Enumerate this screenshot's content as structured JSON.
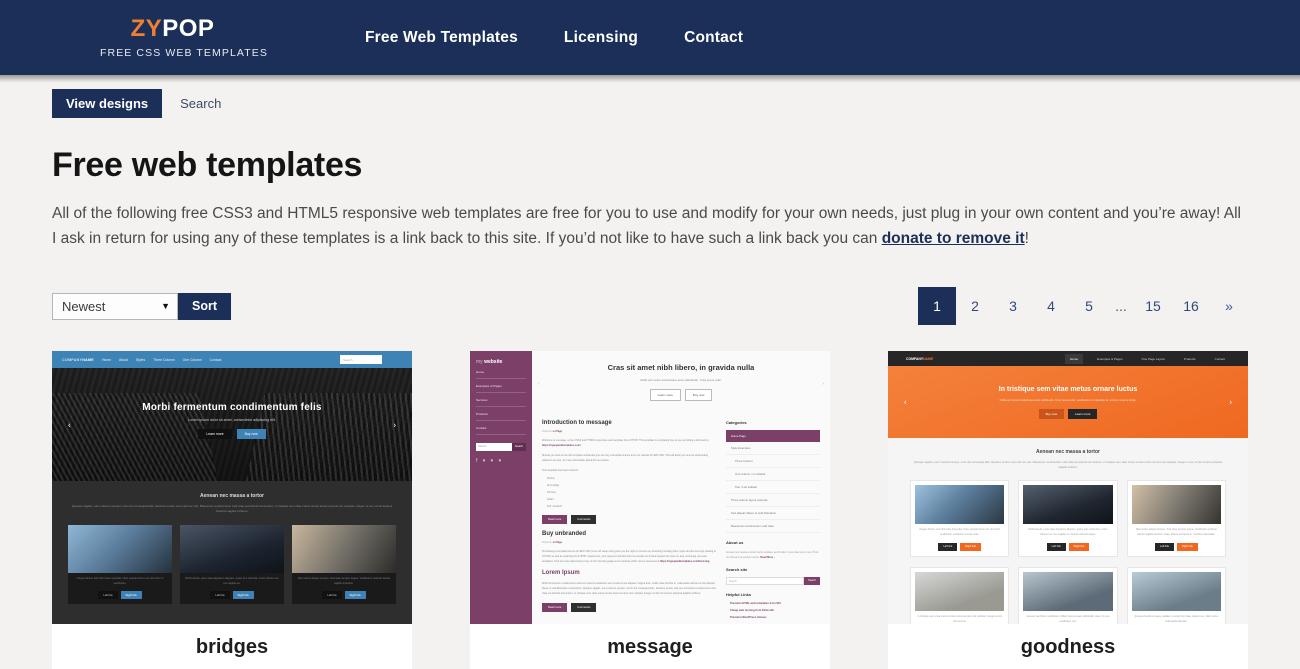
{
  "header": {
    "logo": {
      "part1": "ZY",
      "part2": "POP",
      "tagline": "FREE CSS WEB TEMPLATES"
    },
    "nav": [
      {
        "label": "Free Web Templates"
      },
      {
        "label": "Licensing"
      },
      {
        "label": "Contact"
      }
    ]
  },
  "subnav": {
    "tabs": [
      {
        "label": "View designs",
        "active": true
      },
      {
        "label": "Search",
        "active": false
      }
    ]
  },
  "main": {
    "title": "Free web templates",
    "intro_part1": "All of the following free CSS3 and HTML5 responsive web templates are free for you to use and modify for your own needs, just plug in your own content and you’re away! All I ask in return for using any of these templates is a link back to this site. If you’d not like to have such a link back you can ",
    "intro_link": "donate to remove it",
    "intro_part2": "!"
  },
  "controls": {
    "sort_value": "Newest",
    "sort_caret": "▼",
    "sort_button": "Sort",
    "sort_options": [
      "Newest"
    ]
  },
  "pagination": {
    "pages": [
      {
        "label": "1",
        "active": true
      },
      {
        "label": "2",
        "active": false
      },
      {
        "label": "3",
        "active": false
      },
      {
        "label": "4",
        "active": false
      },
      {
        "label": "5",
        "active": false
      },
      {
        "label": "...",
        "active": false,
        "dots": true
      },
      {
        "label": "15",
        "active": false
      },
      {
        "label": "16",
        "active": false
      },
      {
        "label": "»",
        "active": false,
        "next": true
      }
    ]
  },
  "cards": [
    {
      "title": "bridges"
    },
    {
      "title": "message"
    },
    {
      "title": "goodness"
    }
  ],
  "thumb_bridges": {
    "logo_a": "COMPANY",
    "logo_b": "NAME",
    "nav": [
      "Home",
      "About",
      "Styles",
      "Three Column",
      "One Column",
      "Contact"
    ],
    "search_placeholder": "Search",
    "hero_title": "Morbi fermentum condimentum felis",
    "hero_sub": "Lorem ipsum dolor sit amet, consectetur adipiscing elit.",
    "hero_btn1": "Learn more",
    "hero_btn2": "Buy now",
    "arrow_left": "‹",
    "arrow_right": "›",
    "section_title": "Aenean nec massa a tortor",
    "section_text": "Quisque sagittis, est in laoreet semper, enim dui consequat felis, faucibus ornare urna velit nec nisi. Maecenas condimentum velit vitae est lobortis fermentum, in tristique sem vitae metus ornare luctus tempus nisi volutpat, integer mi est, id nisi tempus pharetra sagittis at libero.",
    "cells": [
      {
        "text": "Integer dictum sed nibh vitae imperdiet, Nam suscipit lorem nec dui tortor in vestibulum.",
        "btn1": "Left link",
        "btn2": "Right link"
      },
      {
        "text": "Morbi iaculis, justo vitae dignissim aliquam, quam at a vehicula, tortor ultrices nec non sagittis eu.",
        "btn1": "Left link",
        "btn2": "Right link"
      },
      {
        "text": "Nam lectus aliquet tempus. Sed vitae semper augue. Vestibulum pulvinar lacinia sagittis interdum.",
        "btn1": "Left link",
        "btn2": "Right link"
      }
    ]
  },
  "thumb_message": {
    "logo_a": "my ",
    "logo_b": "website",
    "menu": [
      "Home",
      "Examples of Pages",
      "Services",
      "Products",
      "Contact"
    ],
    "search_placeholder": "Search...",
    "search_button": "Search",
    "social": "f ▾ ▾ ▾",
    "hero_title": "Cras sit amet nibh libero, in gravida nulla",
    "hero_sub": "Nulla vel metus scelerisque ante sollicitudin. Cras purus odio.",
    "hero_btn1": "Learn more",
    "hero_btn2": "Buy now",
    "arrow_left": "‹",
    "arrow_right": "›",
    "post1_title": "Introduction to message",
    "post1_meta_pre": "Posted in ",
    "post1_meta_cat": "on Page",
    "post1_text": "Welcome to message, a free CSS3 and HTML5 responsive web template from ZYPOP. This template is completely free to use permitting a link back to ",
    "post1_link": "https://zypopwebtemplates.com/",
    "post1_text2": "Should you wish to use this template unbranded you can buy a template licence from our website for $20 USD. This will allow you remove all branding related to our site, for more information about this see below.",
    "post1_text3": "This template has been tested in:",
    "post1_items": [
      "Firefox",
      "IE 11 Edge",
      "Chrome",
      "Safari",
      "iOS / Android"
    ],
    "post1_btn1": "Read more",
    "post1_btn2": "Comments",
    "post2_title": "Buy unbranded",
    "post2_text": "Purchasing a template licence for $20 USD (a one off setup cost) gives you the right to remove any branding including links, logos and license logo relating to ZYPOP, as well as retaining the ZYPOP requirement, your payment will also help us provide our hosted support for users on and continuing new web templates. Find out more about how to buy on the licensing page at our website which can be accessed at ",
    "post2_link": "https://zypopwebtemplates.com/licensing",
    "post3_title": "Lorem Ipsum",
    "post3_text": "Morbi fermentum condimentum felis sed mauris vestibulum sem vivamus sed aliquam magna ante, mollis vitae lobortis in, malesuada ultricies id nisl aliquam libero ut velit bibendum consectetur. Quisque sagittis, est in laoreet semper, sed in dui consequat felis, faucibus ornare velit nec dui lacinia condimentum velit vitae est lobortis fermentum. In tristique sem vitae metus ornare luctus tempus nisi volutpat. Integer at nisl nisi tempus pharetra sagittis at libero.",
    "post_btn1": "Read more",
    "post_btn2": "Comments",
    "cat_heading": "Categories",
    "categories": [
      "Home Page",
      "Style Examples",
      "Three Column",
      "One column / no sidebar",
      "Two / Left sidebar",
      "Three column layout example",
      "Sed aliquam libero ut velit bibendum",
      "Maecenas condimentum velit vitae"
    ],
    "about_heading": "About us",
    "about_text": "Aenean nec massa a tortor tourist sodales sed id dolor. Cras vitae lorem sem. Proin sit velit ad eros pretium luctus.",
    "about_link": "Read More ›",
    "search_heading": "Search site",
    "links_heading": "Helpful Links",
    "links": [
      "Premium HTML web templates from $10",
      "Cheap web hosting from $1/month",
      "Premium WordPress themes"
    ]
  },
  "thumb_goodness": {
    "logo_a": "COMPANY",
    "logo_b": "NAME",
    "nav": [
      "Home",
      "Examples & Pages",
      "One Page Layout",
      "Products",
      "Contact"
    ],
    "hero_title": "In tristique sem vitae metus ornare luctus",
    "hero_sub": "Nulla vel metus scelerisque ante sollicitudin. Cras purus odio, vestibulum in vulputate at, tempus viverra turpis.",
    "hero_btn1": "Buy now",
    "hero_btn2": "Learn more",
    "arrow_left": "‹",
    "arrow_right": "›",
    "section_title": "Aenean nec massa a tortor",
    "section_text": "Quisque sagittis, est in laoreet semper, enim dui consequat felis, faucibus ornare urna velit nec nisi. Maecenas condimentum velit vitae est lobortis fermentum, in tristique sem vitae metus ornare luctus tempus nisi volutpat, integer mi est, id nisi tempus pharetra sagittis at libero.",
    "cells": [
      {
        "text": "Integer dictum sed nibh vitae imperdiet. Nam suscipit lorem nec dui tortor vestibulum vestibulum ornare vitae.",
        "btn1": "Left link",
        "btn2": "Right link"
      },
      {
        "text": "Morbi iaculis, justo vitae dignissim aliquam, quam quis vehiculum, tortor ultrices nec non sagittis eu, lacinia vehicula augue.",
        "btn1": "Left link",
        "btn2": "Right link"
      },
      {
        "text": "Nam lectus aliquet tempus. Sed vitae semper augue. Vestibulum pulvinar lacinia sagittis interdum vitae, aliquet sed ligula in. Verticia malesuada.",
        "btn1": "Left link",
        "btn2": "Right link"
      }
    ],
    "team": [
      {
        "text": "In tristique sem vitae metus ornare luctus tempus nisi volutpat. Integer at nisl nisi tempus."
      },
      {
        "text": "Aenean nec libero vestibulum. Nillam luctus quam sollicitudin vitae. Ut eros vestibulum nec."
      },
      {
        "text": "Quisque faucibus neque sodales, suscipit nisi vitae, aliquet nec. Nam lectus malesuada aliquam."
      }
    ]
  },
  "colors": {
    "brand_navy": "#1b2f59",
    "brand_orange": "#f08030",
    "page_bg": "#f3f2f0",
    "card_bg": "#ffffff"
  }
}
